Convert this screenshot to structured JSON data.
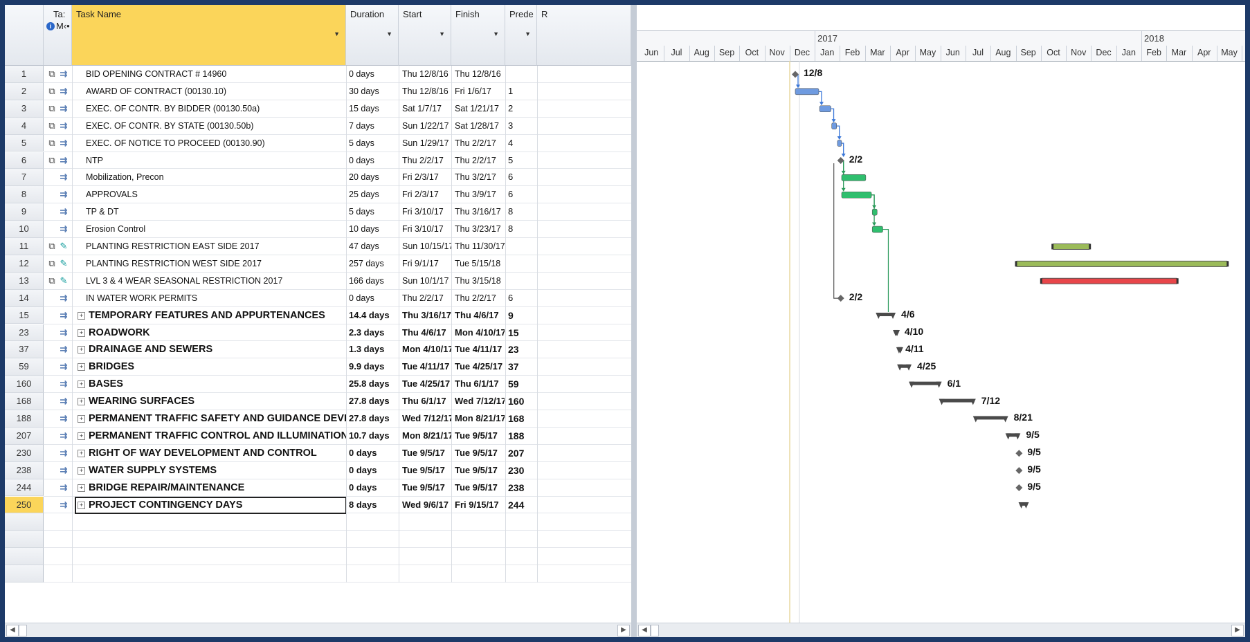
{
  "columns": {
    "task_mode_top": "Ta:",
    "task_mode_bottom": "M‹•",
    "task_name": "Task Name",
    "duration": "Duration",
    "start": "Start",
    "finish": "Finish",
    "predecessors": "Prede",
    "resource": "R"
  },
  "rows": [
    {
      "id": "1",
      "name": "BID OPENING CONTRACT # 14960",
      "dur": "0 days",
      "start": "Thu 12/8/16",
      "finish": "Thu 12/8/16",
      "pred": "",
      "cal": true,
      "mode": "auto",
      "bold": false,
      "summary": false
    },
    {
      "id": "2",
      "name": "AWARD OF CONTRACT (00130.10)",
      "dur": "30 days",
      "start": "Thu 12/8/16",
      "finish": "Fri 1/6/17",
      "pred": "1",
      "cal": true,
      "mode": "auto",
      "bold": false,
      "summary": false
    },
    {
      "id": "3",
      "name": "EXEC. OF CONTR. BY BIDDER (00130.50a)",
      "dur": "15 days",
      "start": "Sat 1/7/17",
      "finish": "Sat 1/21/17",
      "pred": "2",
      "cal": true,
      "mode": "auto",
      "bold": false,
      "summary": false
    },
    {
      "id": "4",
      "name": "EXEC. OF CONTR. BY STATE (00130.50b)",
      "dur": "7 days",
      "start": "Sun 1/22/17",
      "finish": "Sat 1/28/17",
      "pred": "3",
      "cal": true,
      "mode": "auto",
      "bold": false,
      "summary": false
    },
    {
      "id": "5",
      "name": "EXEC. OF NOTICE TO PROCEED (00130.90)",
      "dur": "5 days",
      "start": "Sun 1/29/17",
      "finish": "Thu 2/2/17",
      "pred": "4",
      "cal": true,
      "mode": "auto",
      "bold": false,
      "summary": false
    },
    {
      "id": "6",
      "name": "NTP",
      "dur": "0 days",
      "start": "Thu 2/2/17",
      "finish": "Thu 2/2/17",
      "pred": "5",
      "cal": true,
      "mode": "auto",
      "bold": false,
      "summary": false
    },
    {
      "id": "7",
      "name": "Mobilization, Precon",
      "dur": "20 days",
      "start": "Fri 2/3/17",
      "finish": "Thu 3/2/17",
      "pred": "6",
      "cal": false,
      "mode": "auto",
      "bold": false,
      "summary": false
    },
    {
      "id": "8",
      "name": "APPROVALS",
      "dur": "25 days",
      "start": "Fri 2/3/17",
      "finish": "Thu 3/9/17",
      "pred": "6",
      "cal": false,
      "mode": "auto",
      "bold": false,
      "summary": false
    },
    {
      "id": "9",
      "name": "TP & DT",
      "dur": "5 days",
      "start": "Fri 3/10/17",
      "finish": "Thu 3/16/17",
      "pred": "8",
      "cal": false,
      "mode": "auto",
      "bold": false,
      "summary": false
    },
    {
      "id": "10",
      "name": "Erosion Control",
      "dur": "10 days",
      "start": "Fri 3/10/17",
      "finish": "Thu 3/23/17",
      "pred": "8",
      "cal": false,
      "mode": "auto",
      "bold": false,
      "summary": false
    },
    {
      "id": "11",
      "name": "PLANTING RESTRICTION EAST SIDE 2017",
      "dur": "47 days",
      "start": "Sun 10/15/17",
      "finish": "Thu 11/30/17",
      "pred": "",
      "cal": true,
      "mode": "manual",
      "bold": false,
      "summary": false
    },
    {
      "id": "12",
      "name": "PLANTING RESTRICTION WEST SIDE 2017",
      "dur": "257 days",
      "start": "Fri 9/1/17",
      "finish": "Tue 5/15/18",
      "pred": "",
      "cal": true,
      "mode": "manual",
      "bold": false,
      "summary": false
    },
    {
      "id": "13",
      "name": "LVL 3 & 4 WEAR SEASONAL RESTRICTION 2017",
      "dur": "166 days",
      "start": "Sun 10/1/17",
      "finish": "Thu 3/15/18",
      "pred": "",
      "cal": true,
      "mode": "manual",
      "bold": false,
      "summary": false
    },
    {
      "id": "14",
      "name": "IN WATER WORK PERMITS",
      "dur": "0 days",
      "start": "Thu 2/2/17",
      "finish": "Thu 2/2/17",
      "pred": "6",
      "cal": false,
      "mode": "auto",
      "bold": false,
      "summary": false
    },
    {
      "id": "15",
      "name": "TEMPORARY FEATURES AND APPURTENANCES",
      "dur": "14.4 days",
      "start": "Thu 3/16/17",
      "finish": "Thu 4/6/17",
      "pred": "9",
      "cal": false,
      "mode": "auto",
      "bold": true,
      "summary": true
    },
    {
      "id": "23",
      "name": "ROADWORK",
      "dur": "2.3 days",
      "start": "Thu 4/6/17",
      "finish": "Mon 4/10/17",
      "pred": "15",
      "cal": false,
      "mode": "auto",
      "bold": true,
      "summary": true
    },
    {
      "id": "37",
      "name": "DRAINAGE AND SEWERS",
      "dur": "1.3 days",
      "start": "Mon 4/10/17",
      "finish": "Tue 4/11/17",
      "pred": "23",
      "cal": false,
      "mode": "auto",
      "bold": true,
      "summary": true
    },
    {
      "id": "59",
      "name": "BRIDGES",
      "dur": "9.9 days",
      "start": "Tue 4/11/17",
      "finish": "Tue 4/25/17",
      "pred": "37",
      "cal": false,
      "mode": "auto",
      "bold": true,
      "summary": true
    },
    {
      "id": "160",
      "name": "BASES",
      "dur": "25.8 days",
      "start": "Tue 4/25/17",
      "finish": "Thu 6/1/17",
      "pred": "59",
      "cal": false,
      "mode": "auto",
      "bold": true,
      "summary": true
    },
    {
      "id": "168",
      "name": "WEARING SURFACES",
      "dur": "27.8 days",
      "start": "Thu 6/1/17",
      "finish": "Wed 7/12/17",
      "pred": "160",
      "cal": false,
      "mode": "auto",
      "bold": true,
      "summary": true
    },
    {
      "id": "188",
      "name": "PERMANENT TRAFFIC SAFETY AND GUIDANCE DEVICES",
      "dur": "27.8 days",
      "start": "Wed 7/12/17",
      "finish": "Mon 8/21/17",
      "pred": "168",
      "cal": false,
      "mode": "auto",
      "bold": true,
      "summary": true
    },
    {
      "id": "207",
      "name": "PERMANENT TRAFFIC CONTROL AND ILLUMINATION SYSTEMS",
      "dur": "10.7 days",
      "start": "Mon 8/21/17",
      "finish": "Tue 9/5/17",
      "pred": "188",
      "cal": false,
      "mode": "auto",
      "bold": true,
      "summary": true
    },
    {
      "id": "230",
      "name": "RIGHT OF WAY DEVELOPMENT AND CONTROL",
      "dur": "0 days",
      "start": "Tue 9/5/17",
      "finish": "Tue 9/5/17",
      "pred": "207",
      "cal": false,
      "mode": "auto",
      "bold": true,
      "summary": true
    },
    {
      "id": "238",
      "name": "WATER SUPPLY SYSTEMS",
      "dur": "0 days",
      "start": "Tue 9/5/17",
      "finish": "Tue 9/5/17",
      "pred": "230",
      "cal": false,
      "mode": "auto",
      "bold": true,
      "summary": true
    },
    {
      "id": "244",
      "name": "BRIDGE REPAIR/MAINTENANCE",
      "dur": "0 days",
      "start": "Tue 9/5/17",
      "finish": "Tue 9/5/17",
      "pred": "238",
      "cal": false,
      "mode": "auto",
      "bold": true,
      "summary": true
    },
    {
      "id": "250",
      "name": "PROJECT CONTINGENCY DAYS",
      "dur": "8 days",
      "start": "Wed 9/6/17",
      "finish": "Fri 9/15/17",
      "pred": "244",
      "cal": false,
      "mode": "auto",
      "bold": true,
      "summary": true
    }
  ],
  "selected_row": "250",
  "timescale": {
    "years": [
      {
        "label": "2017",
        "month_index": 7
      },
      {
        "label": "2018",
        "month_index": 20
      }
    ],
    "months": [
      "Jun",
      "Jul",
      "Aug",
      "Sep",
      "Oct",
      "Nov",
      "Dec",
      "Jan",
      "Feb",
      "Mar",
      "Apr",
      "May",
      "Jun",
      "Jul",
      "Aug",
      "Sep",
      "Oct",
      "Nov",
      "Dec",
      "Jan",
      "Feb",
      "Mar",
      "Apr",
      "May"
    ],
    "first_month": "2016-06",
    "status_line_date": "2016-12-08"
  },
  "gantt_labels": [
    {
      "row": 0,
      "text": "12/8"
    },
    {
      "row": 5,
      "text": "2/2"
    },
    {
      "row": 13,
      "text": "2/2"
    },
    {
      "row": 14,
      "text": "4/6"
    },
    {
      "row": 15,
      "text": "4/10"
    },
    {
      "row": 16,
      "text": "4/11"
    },
    {
      "row": 17,
      "text": "4/25"
    },
    {
      "row": 18,
      "text": "6/1"
    },
    {
      "row": 19,
      "text": "7/12"
    },
    {
      "row": 20,
      "text": "8/21"
    },
    {
      "row": 21,
      "text": "9/5"
    },
    {
      "row": 22,
      "text": "9/5"
    },
    {
      "row": 23,
      "text": "9/5"
    },
    {
      "row": 24,
      "text": "9/5"
    }
  ],
  "bars": [
    {
      "row": 1,
      "start": "2016-12-08",
      "finish": "2017-01-06",
      "kind": "blue"
    },
    {
      "row": 2,
      "start": "2017-01-07",
      "finish": "2017-01-21",
      "kind": "blue"
    },
    {
      "row": 3,
      "start": "2017-01-22",
      "finish": "2017-01-28",
      "kind": "blue"
    },
    {
      "row": 4,
      "start": "2017-01-29",
      "finish": "2017-02-02",
      "kind": "blue"
    },
    {
      "row": 6,
      "start": "2017-02-03",
      "finish": "2017-03-02",
      "kind": "green"
    },
    {
      "row": 7,
      "start": "2017-02-03",
      "finish": "2017-03-09",
      "kind": "green"
    },
    {
      "row": 8,
      "start": "2017-03-10",
      "finish": "2017-03-16",
      "kind": "green"
    },
    {
      "row": 9,
      "start": "2017-03-10",
      "finish": "2017-03-23",
      "kind": "green"
    },
    {
      "row": 10,
      "start": "2017-10-15",
      "finish": "2017-11-30",
      "kind": "olive"
    },
    {
      "row": 11,
      "start": "2017-09-01",
      "finish": "2018-05-15",
      "kind": "olive"
    },
    {
      "row": 12,
      "start": "2017-10-01",
      "finish": "2018-03-15",
      "kind": "red"
    },
    {
      "row": 14,
      "start": "2017-03-16",
      "finish": "2017-04-06",
      "kind": "summary"
    },
    {
      "row": 15,
      "start": "2017-04-06",
      "finish": "2017-04-10",
      "kind": "summary"
    },
    {
      "row": 16,
      "start": "2017-04-10",
      "finish": "2017-04-11",
      "kind": "summary"
    },
    {
      "row": 17,
      "start": "2017-04-11",
      "finish": "2017-04-25",
      "kind": "summary"
    },
    {
      "row": 18,
      "start": "2017-04-25",
      "finish": "2017-06-01",
      "kind": "summary"
    },
    {
      "row": 19,
      "start": "2017-06-01",
      "finish": "2017-07-12",
      "kind": "summary"
    },
    {
      "row": 20,
      "start": "2017-07-12",
      "finish": "2017-08-21",
      "kind": "summary"
    },
    {
      "row": 21,
      "start": "2017-08-21",
      "finish": "2017-09-05",
      "kind": "summary"
    },
    {
      "row": 25,
      "start": "2017-09-06",
      "finish": "2017-09-15",
      "kind": "summary"
    }
  ],
  "milestones": [
    {
      "row": 0,
      "date": "2016-12-08"
    },
    {
      "row": 5,
      "date": "2017-02-02"
    },
    {
      "row": 13,
      "date": "2017-02-02"
    },
    {
      "row": 22,
      "date": "2017-09-05"
    },
    {
      "row": 23,
      "date": "2017-09-05"
    },
    {
      "row": 24,
      "date": "2017-09-05"
    }
  ],
  "colors": {
    "frame": "#1d3a68",
    "header_selected": "#fbd55a",
    "bar_blue": "#6f9be0",
    "bar_green": "#2fbf6e",
    "bar_olive": "#9bbb59",
    "bar_red": "#e8464a",
    "summary": "#4a4a4a",
    "link_blue": "#3c78d8",
    "link_green": "#2a9a5a",
    "status_line": "#e8d8a0"
  }
}
